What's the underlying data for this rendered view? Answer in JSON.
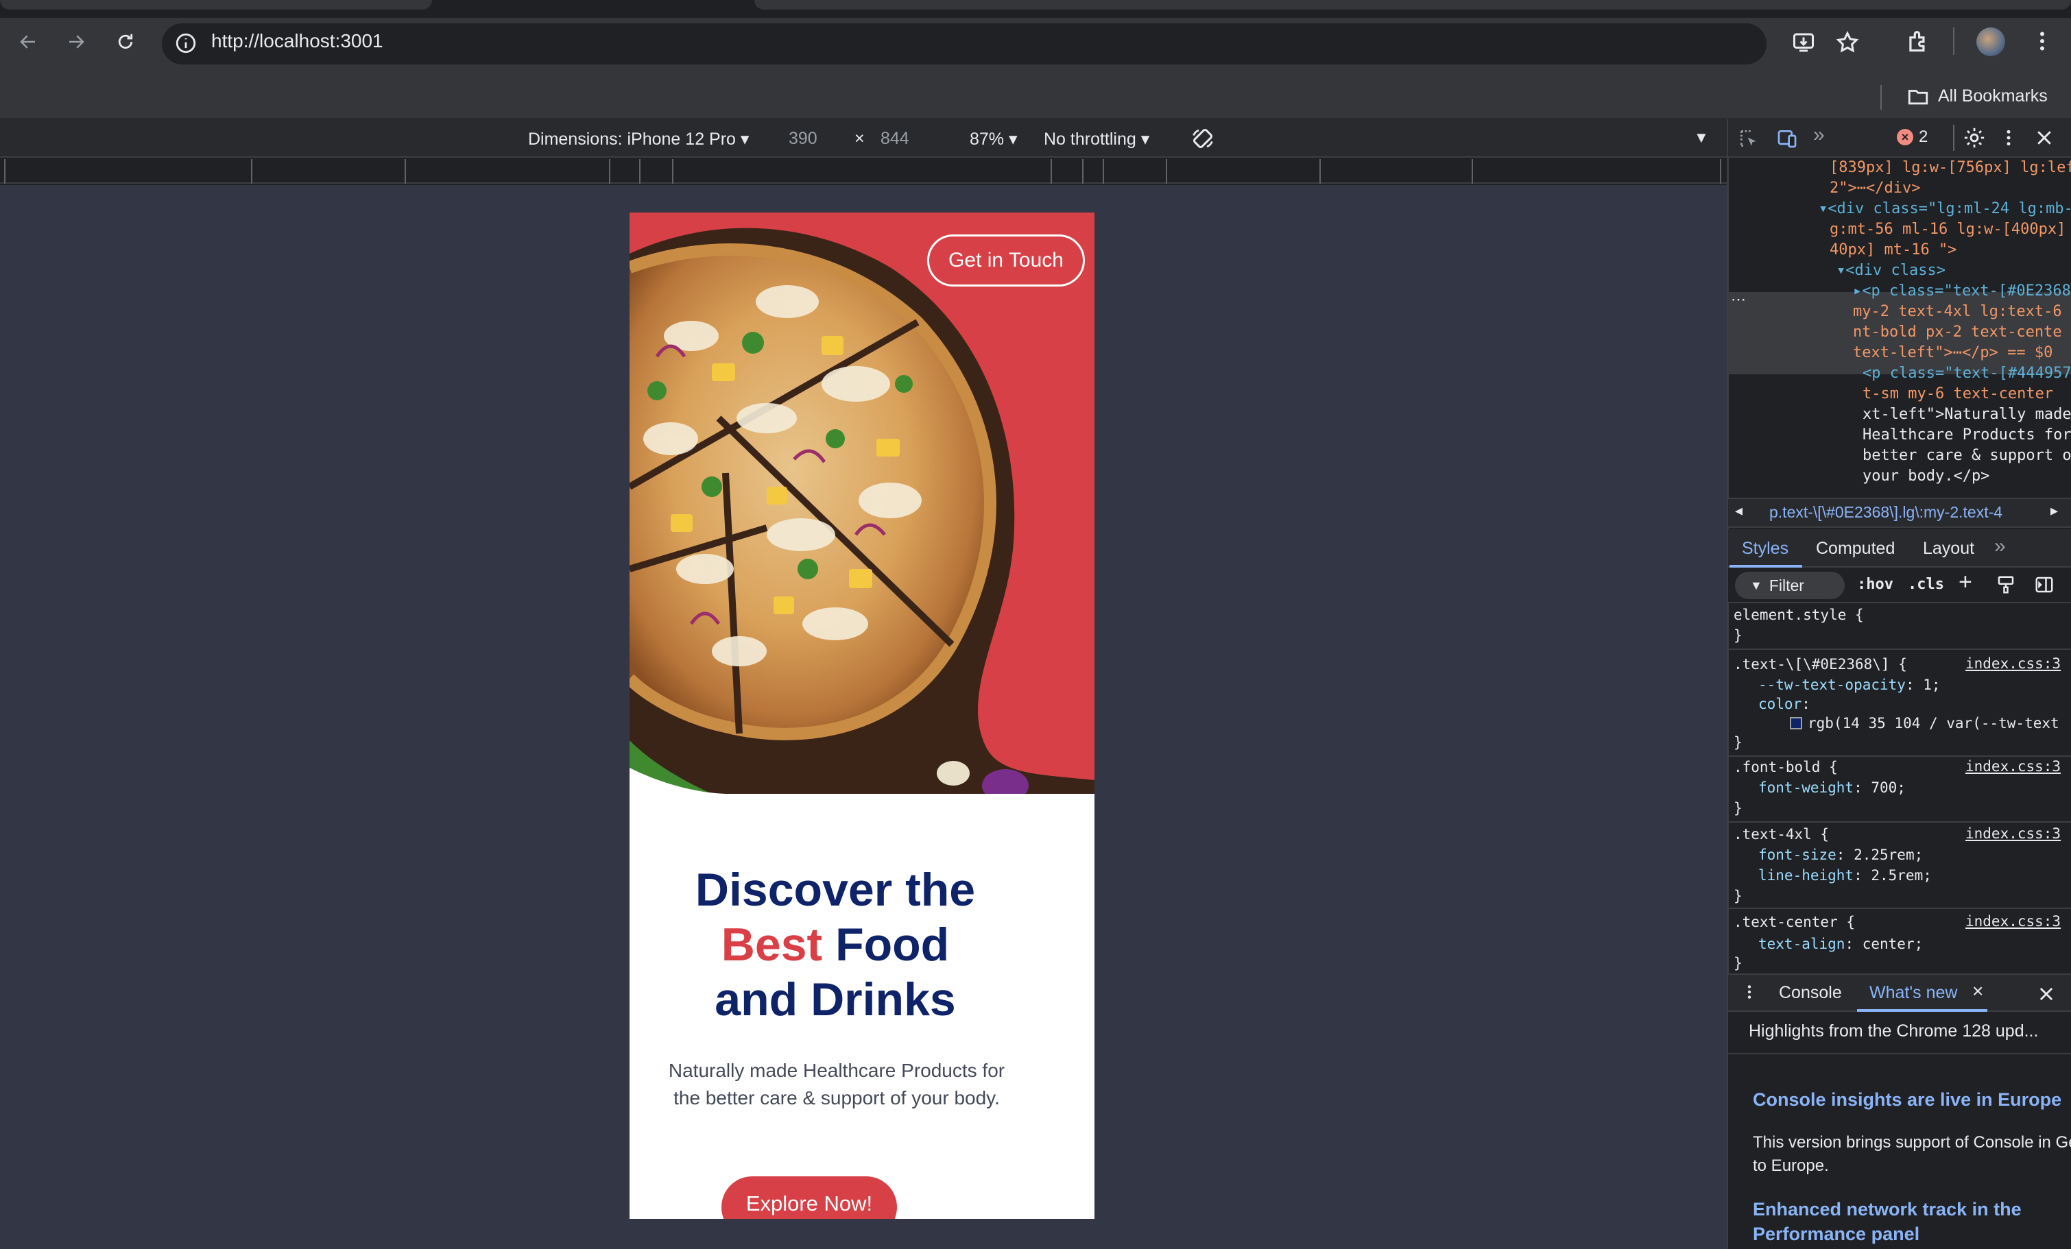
{
  "browser": {
    "url": "http://localhost:3001",
    "bookmarks_label": "All Bookmarks"
  },
  "device_toolbar": {
    "dimensions_label": "Dimensions: iPhone 12 Pro",
    "width": "390",
    "times": "×",
    "height": "844",
    "zoom": "87%",
    "throttling": "No throttling"
  },
  "page": {
    "cta_top": "Get in Touch",
    "headline_line1": "Discover the",
    "headline_red": "Best",
    "headline_line2_rest": " Food",
    "headline_line3": "and Drinks",
    "subtitle": "Naturally made Healthcare Products for the better care & support of your body.",
    "cta_main": "Explore Now!"
  },
  "devtools": {
    "error_count": "2",
    "dom_lines": [
      {
        "t": "[839px] lg:w-[756px] lg:lef",
        "c": "aval"
      },
      {
        "t": "2\">⋯</div>",
        "c": "aval"
      },
      {
        "t": "▾<div class=\"lg:ml-24 lg:mb-",
        "c": "tag"
      },
      {
        "t": "g:mt-56 ml-16 lg:w-[400px]",
        "c": "aval"
      },
      {
        "t": "40px] mt-16 \">",
        "c": "aval"
      },
      {
        "t": "▾<div class>",
        "c": "tag"
      },
      {
        "t": "▸<p class=\"text-[#0E2368",
        "c": "tag"
      },
      {
        "t": "my-2 text-4xl lg:text-6",
        "c": "aval"
      },
      {
        "t": "nt-bold px-2 text-cente",
        "c": "aval"
      },
      {
        "t": "text-left\">⋯</p> == $0",
        "c": "aval"
      },
      {
        "t": "<p class=\"text-[#444957",
        "c": "tag"
      },
      {
        "t": "t-sm my-6  text-center",
        "c": "aval"
      },
      {
        "t": "xt-left\">Naturally made",
        "c": "txt"
      },
      {
        "t": "Healthcare Products for",
        "c": "txt"
      },
      {
        "t": "better care & support o",
        "c": "txt"
      },
      {
        "t": "your body.</p>",
        "c": "txt"
      }
    ],
    "breadcrumb": "p.text-\\[\\#0E2368\\].lg\\:my-2.text-4",
    "tabs": [
      "Styles",
      "Computed",
      "Layout"
    ],
    "filter_placeholder": "Filter",
    "hov": ":hov",
    "cls": ".cls",
    "rules": {
      "element_style": "element.style {",
      "close": "}",
      "r1_selector": ".text-\\[\\#0E2368\\] {",
      "r1_src": "index.css:3",
      "r1_p1": "--tw-text-opacity",
      "r1_v1": ": 1;",
      "r1_p2": "color",
      "r1_v2": ":",
      "r1_v3": "rgb(14 35 104 / var(--tw-text",
      "r2_selector": ".font-bold {",
      "r2_src": "index.css:3",
      "r2_p1": "font-weight",
      "r2_v1": ": 700;",
      "r3_selector": ".text-4xl {",
      "r3_src": "index.css:3",
      "r3_p1": "font-size",
      "r3_v1": ": 2.25rem;",
      "r3_p2": "line-height",
      "r3_v2": ": 2.5rem;",
      "r4_selector": ".text-center {",
      "r4_src": "index.css:3",
      "r4_p1": "text-align",
      "r4_v1": ": center;"
    },
    "drawer": {
      "console_tab": "Console",
      "whats_new_tab": "What's new",
      "highlights": "Highlights from the Chrome 128 upd...",
      "h1": "Console insights are live in Europe",
      "p1": "This version brings support of Console in Gemini to Europe.",
      "h2": "Enhanced network track in the Performance panel"
    }
  }
}
